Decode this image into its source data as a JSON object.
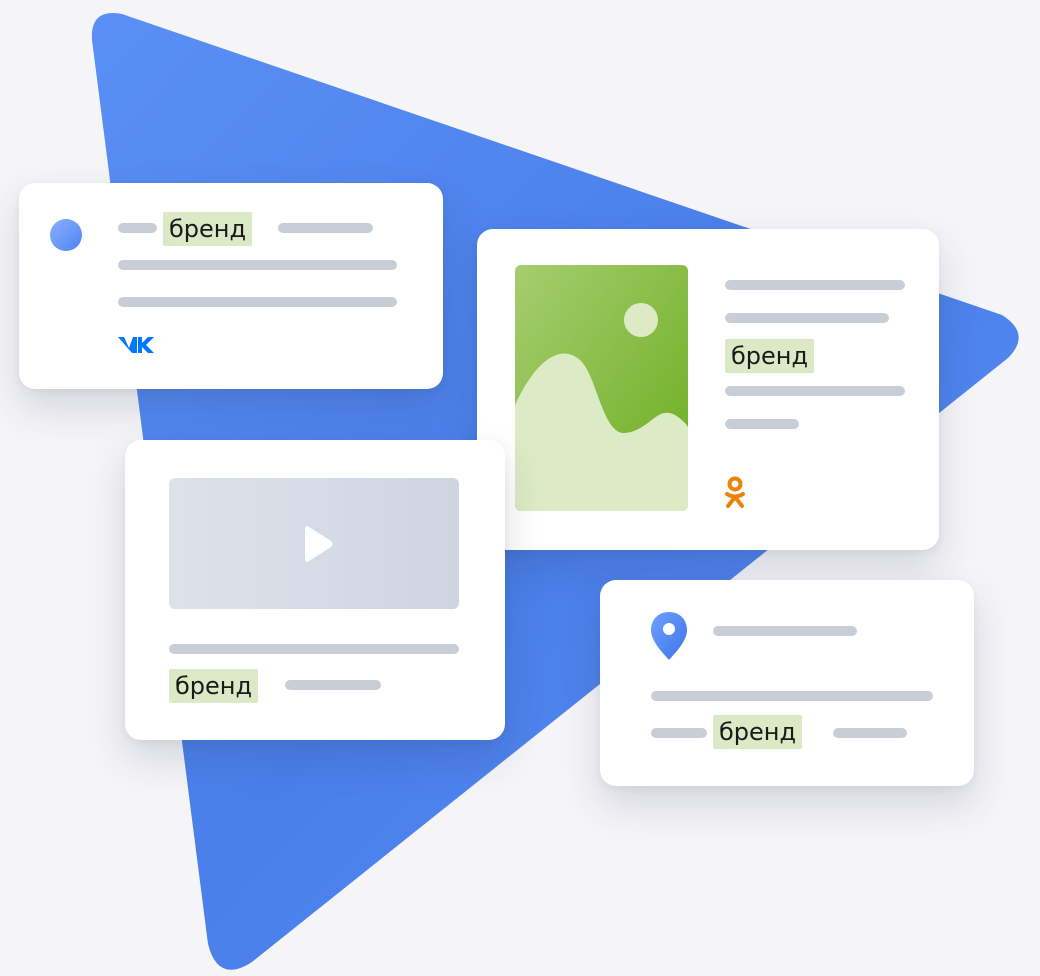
{
  "brand_word": "бренд",
  "colors": {
    "background": "#f5f5f8",
    "triangle": "#4f86f2",
    "card": "#ffffff",
    "placeholder_bar": "#c9cdd6",
    "brand_highlight": "#dbe9c6",
    "vk_blue": "#0077ff",
    "ok_orange": "#ee8208",
    "image_green": "#8fc25a",
    "video_placeholder": "#d6dbe6"
  },
  "icons": {
    "vk": "vk-logo-icon",
    "ok": "ok-logo-icon",
    "play": "play-icon",
    "pin": "location-pin-icon",
    "image": "landscape-image-icon"
  }
}
